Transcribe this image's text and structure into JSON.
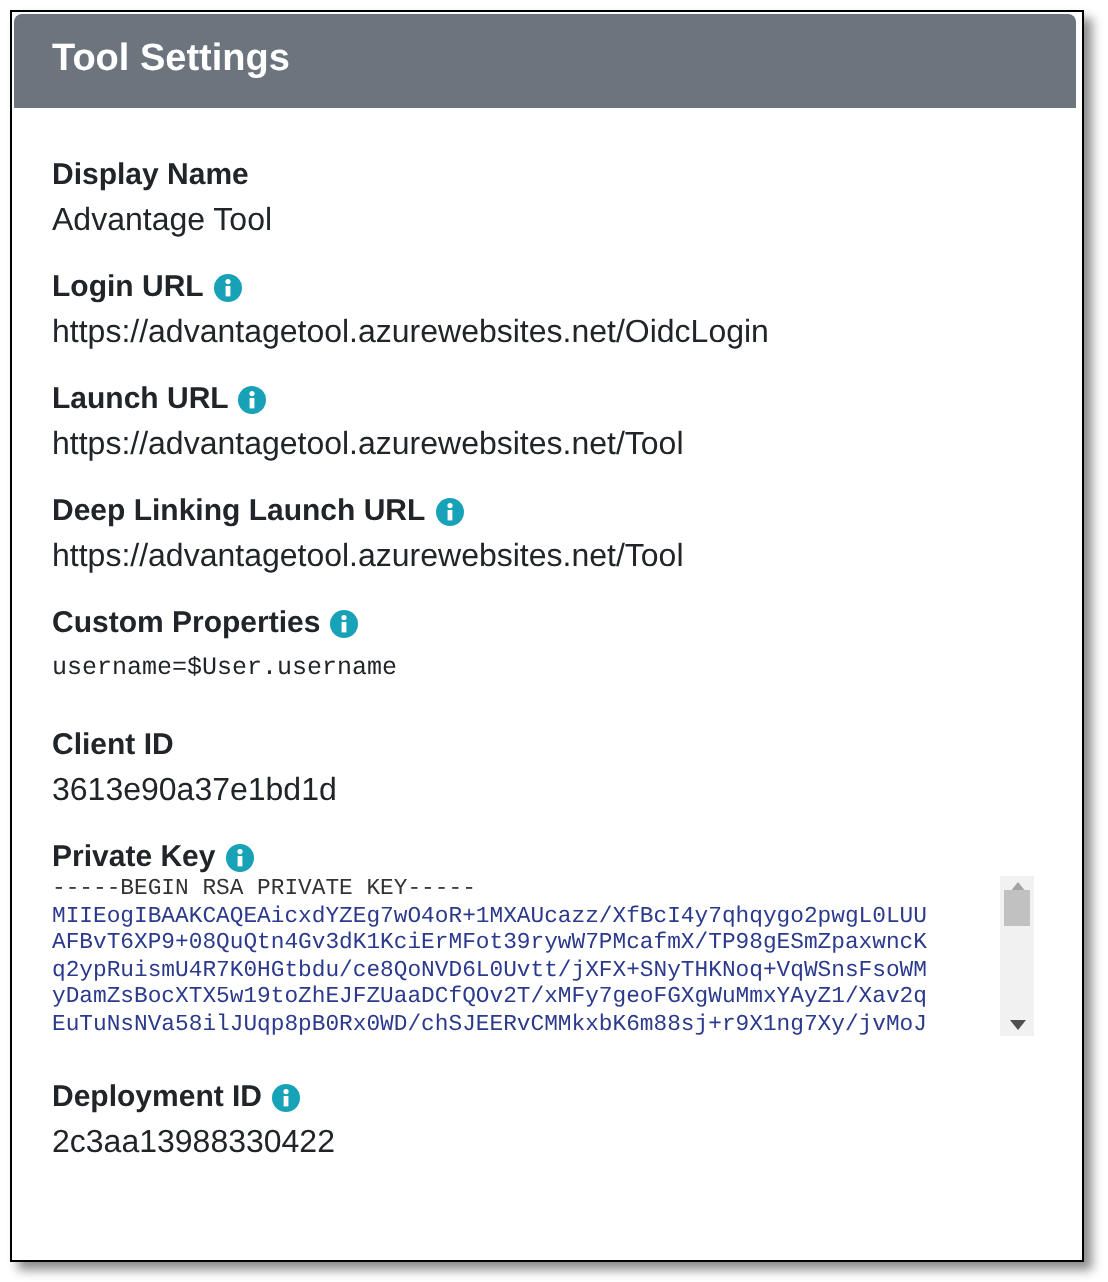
{
  "panel": {
    "title": "Tool Settings"
  },
  "fields": [
    {
      "kind": "text",
      "label": "Display Name",
      "info": false,
      "value": "Advantage Tool"
    },
    {
      "kind": "text",
      "label": "Login URL",
      "info": true,
      "value": "https://advantagetool.azurewebsites.net/OidcLogin"
    },
    {
      "kind": "text",
      "label": "Launch URL",
      "info": true,
      "value": "https://advantagetool.azurewebsites.net/Tool"
    },
    {
      "kind": "text",
      "label": "Deep Linking Launch URL",
      "info": true,
      "value": "https://advantagetool.azurewebsites.net/Tool"
    },
    {
      "kind": "mono",
      "label": "Custom Properties",
      "info": true,
      "value": "username=$User.username"
    },
    {
      "kind": "text",
      "label": "Client ID",
      "info": false,
      "value": "3613e90a37e1bd1d"
    },
    {
      "kind": "key",
      "label": "Private Key",
      "info": true,
      "lines": [
        "-----BEGIN RSA PRIVATE KEY-----",
        "MIIEogIBAAKCAQEAicxdYZEg7wO4oR+1MXAUcazz/XfBcI4y7qhqygo2pwgL0LUU",
        "AFBvT6XP9+08QuQtn4Gv3dK1KciErMFot39rywW7PMcafmX/TP98gESmZpaxwncK",
        "q2ypRuismU4R7K0HGtbdu/ce8QoNVD6L0Uvtt/jXFX+SNyTHKNoq+VqWSnsFsoWM",
        "yDamZsBocXTX5w19toZhEJFZUaaDCfQOv2T/xMFy7geoFGXgWuMmxYAyZ1/Xav2q",
        "EuTuNsNVa58ilJUqp8pB0Rx0WD/chSJEERvCMMkxbK6m88sj+r9X1ng7Xy/jvMoJ"
      ]
    },
    {
      "kind": "text",
      "label": "Deployment ID",
      "info": true,
      "value": "2c3aa13988330422"
    }
  ]
}
